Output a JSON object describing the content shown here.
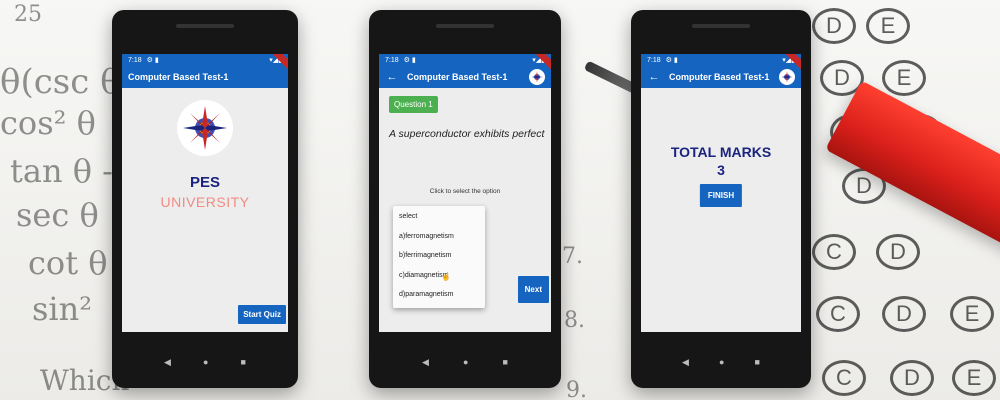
{
  "background": {
    "math_lines": [
      "25",
      "θ(csc θ",
      "cos² θ",
      "tan θ -",
      "sec θ",
      "cot θ",
      "sin²",
      "Which"
    ],
    "answer_bubbles": [
      "D",
      "E",
      "D",
      "E",
      "D",
      "E",
      "D",
      "E",
      "C",
      "D",
      "C",
      "D",
      "E",
      "C",
      "D",
      "E"
    ],
    "page_numbers": [
      "7.",
      "8.",
      "9."
    ]
  },
  "status": {
    "time": "7:18",
    "icons": "⚙ ▮",
    "right_icons": "▾◢▮"
  },
  "screen1": {
    "app_title": "Computer Based Test-1",
    "name_line1": "PES",
    "name_line2": "UNIVERSITY",
    "start_button": "Start Quiz"
  },
  "screen2": {
    "app_title": "Computer Based Test-1",
    "question_chip": "Question 1",
    "question_text": "A superconductor exhibits perfect",
    "hint": "Click to select the option",
    "options": [
      "select",
      "a)ferromagnetism",
      "b)ferrimagnetism",
      "c)diamagnetism",
      "d)paramagnetism"
    ],
    "next_button": "Next"
  },
  "screen3": {
    "app_title": "Computer Based Test-1",
    "total_label": "TOTAL MARKS",
    "total_value": "3",
    "finish_button": "FINISH"
  },
  "colors": {
    "primary": "#1565c0",
    "green": "#4caf50",
    "title_navy": "#1a237e",
    "university_pink": "#f28b82"
  },
  "icons": {
    "back": "arrow-left-icon",
    "logo": "pes-compass-logo",
    "cursor": "hand-cursor-icon"
  }
}
